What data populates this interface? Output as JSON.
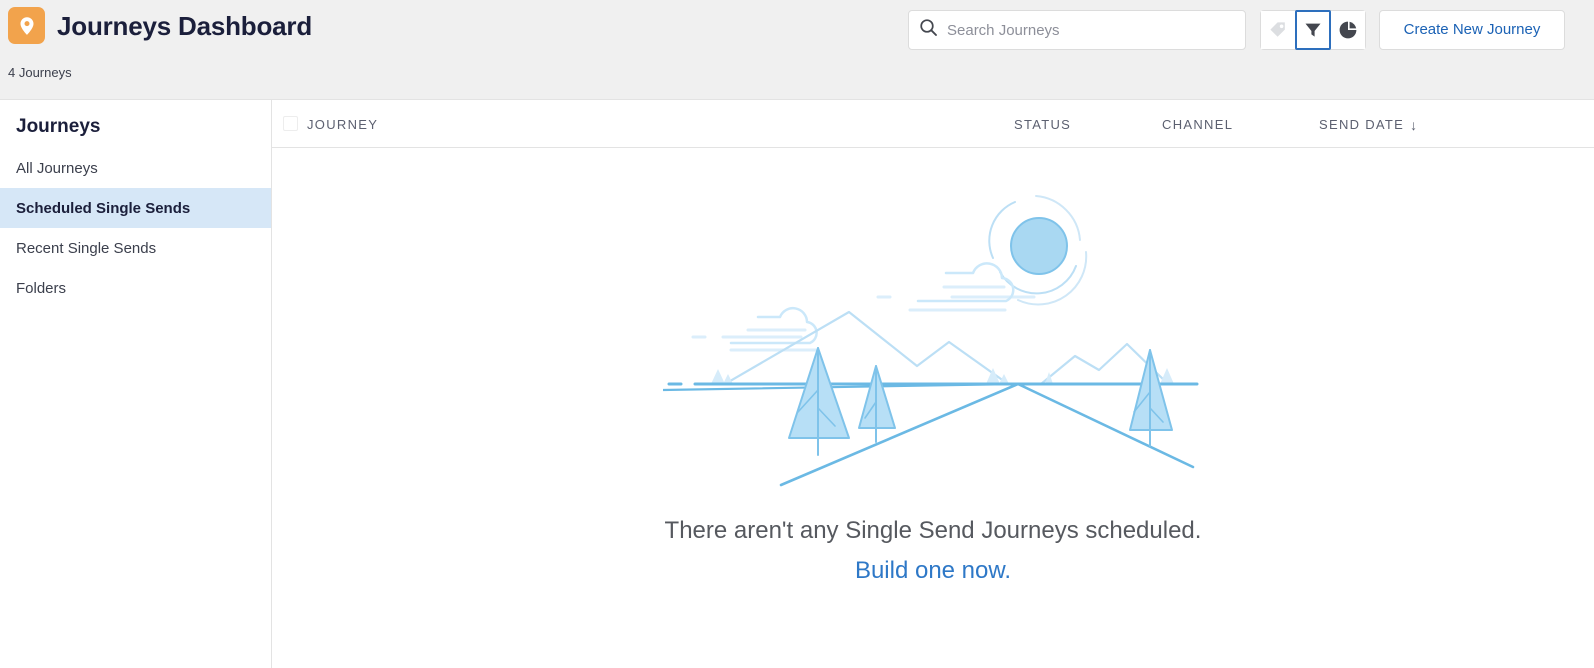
{
  "header": {
    "app_icon": "location-pin-icon",
    "app_icon_color": "#f2a34c",
    "title": "Journeys Dashboard",
    "subtitle": "4 Journeys",
    "search": {
      "icon": "search-icon",
      "placeholder": "Search Journeys",
      "value": ""
    },
    "icon_buttons": [
      {
        "name": "tag-icon",
        "label": "Tags",
        "state": "disabled"
      },
      {
        "name": "filter-icon",
        "label": "Filter",
        "state": "focused"
      },
      {
        "name": "pie-chart-icon",
        "label": "Stats",
        "state": "default"
      }
    ],
    "create_button": "Create New Journey",
    "create_button_color": "#1b62b5"
  },
  "sidebar": {
    "title": "Journeys",
    "items": [
      {
        "label": "All Journeys",
        "active": false
      },
      {
        "label": "Scheduled Single Sends",
        "active": true
      },
      {
        "label": "Recent Single Sends",
        "active": false
      },
      {
        "label": "Folders",
        "active": false
      }
    ],
    "active_bg": "#d6e7f7"
  },
  "table": {
    "select_all_checkbox": "unchecked",
    "columns": [
      {
        "key": "journey",
        "label": "JOURNEY"
      },
      {
        "key": "status",
        "label": "STATUS"
      },
      {
        "key": "channel",
        "label": "CHANNEL"
      },
      {
        "key": "send_date",
        "label": "SEND DATE",
        "sort": "descending",
        "sort_glyph": "↓"
      }
    ],
    "rows": []
  },
  "empty_state": {
    "illustration": "mountains-sun-trees-illustration",
    "message": "There aren't any Single Send Journeys scheduled.",
    "link": "Build one now.",
    "link_color": "#2e78c7"
  }
}
